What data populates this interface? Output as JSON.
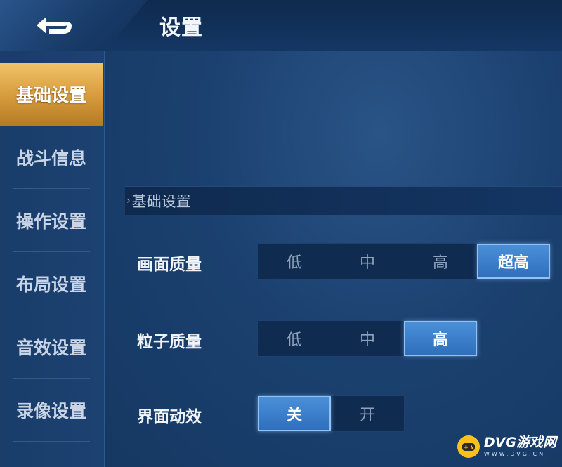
{
  "header": {
    "title": "设置"
  },
  "sidebar": {
    "items": [
      {
        "label": "基础设置",
        "active": true
      },
      {
        "label": "战斗信息",
        "active": false
      },
      {
        "label": "操作设置",
        "active": false
      },
      {
        "label": "布局设置",
        "active": false
      },
      {
        "label": "音效设置",
        "active": false
      },
      {
        "label": "录像设置",
        "active": false
      }
    ]
  },
  "section": {
    "title": "基础设置"
  },
  "settings": {
    "graphics_quality": {
      "label": "画面质量",
      "options": [
        "低",
        "中",
        "高",
        "超高"
      ],
      "selected": "超高"
    },
    "particle_quality": {
      "label": "粒子质量",
      "options": [
        "低",
        "中",
        "高"
      ],
      "selected": "高"
    },
    "ui_animation": {
      "label": "界面动效",
      "options": [
        "关",
        "开"
      ],
      "selected": "关"
    }
  },
  "watermark": {
    "main": "DVG游戏网",
    "sub": "WWW.DVG.CN"
  },
  "colors": {
    "accent_gold": "#d59a3a",
    "accent_blue": "#3a7fcc",
    "background": "#16365f"
  }
}
